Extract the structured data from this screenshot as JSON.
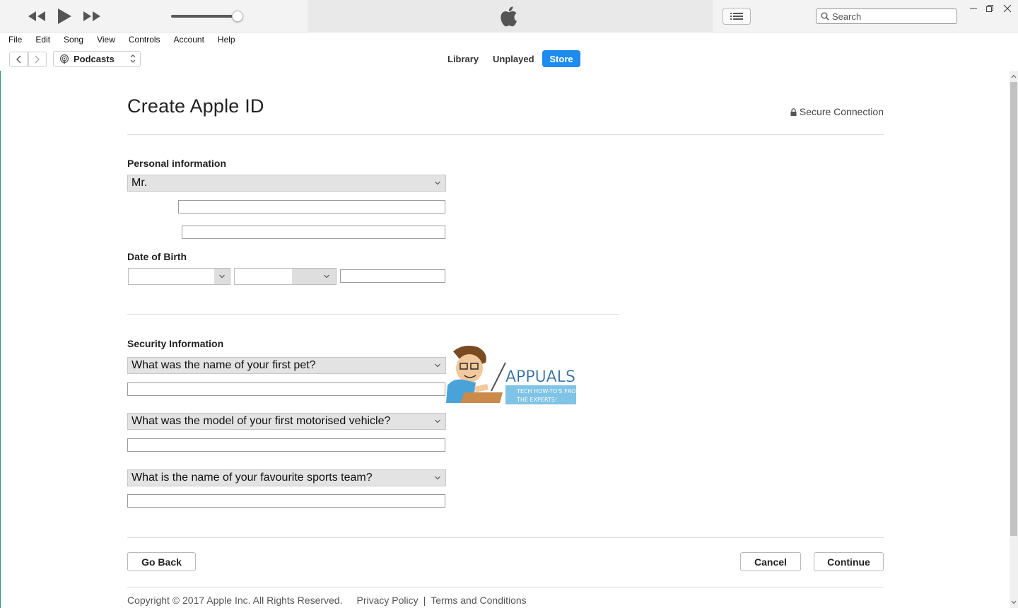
{
  "titlebar": {
    "search_placeholder": "Search"
  },
  "menubar": {
    "items": [
      "File",
      "Edit",
      "Song",
      "View",
      "Controls",
      "Account",
      "Help"
    ]
  },
  "navbar": {
    "media_kind": "Podcasts",
    "tabs": [
      {
        "label": "Library",
        "active": false
      },
      {
        "label": "Unplayed",
        "active": false
      },
      {
        "label": "Store",
        "active": true
      }
    ]
  },
  "page": {
    "title": "Create Apple ID",
    "secure_label": "Secure Connection",
    "personal_label": "Personal information",
    "salutation": "Mr.",
    "first_name": "",
    "last_name": "",
    "dob_label": "Date of Birth",
    "dob_day": "",
    "dob_month": "",
    "dob_year": "",
    "security_label": "Security Information",
    "questions": [
      {
        "question": "What was the name of your first pet?",
        "answer": ""
      },
      {
        "question": "What was the model of your first motorised vehicle?",
        "answer": ""
      },
      {
        "question": "What is the name of your favourite sports team?",
        "answer": ""
      }
    ],
    "go_back": "Go Back",
    "cancel": "Cancel",
    "continue": "Continue",
    "copyright": "Copyright © 2017 Apple Inc. All Rights Reserved.",
    "privacy": "Privacy Policy",
    "footer_separator": "|",
    "terms": "Terms and Conditions"
  },
  "watermark": {
    "brand": "APPUALS",
    "tagline_1": "TECH HOW-TO'S FROM",
    "tagline_2": "THE EXPERTS!"
  },
  "colors": {
    "store_tab": "#1d8bf0",
    "chrome": "#f3f3f3",
    "lcd": "#e9e9e9",
    "select_bg": "#e3e3e3"
  }
}
